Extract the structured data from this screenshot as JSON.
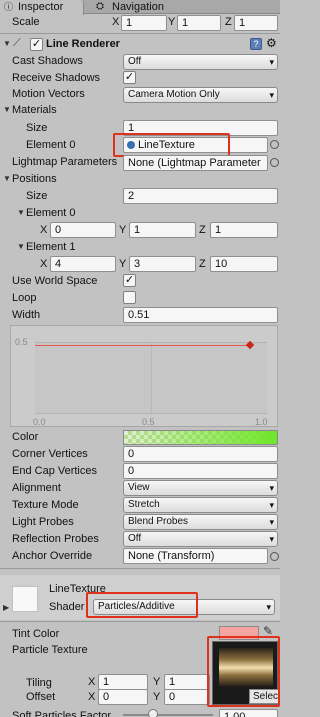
{
  "tabs": {
    "inspector": "Inspector",
    "navigation": "Navigation"
  },
  "scale": {
    "label": "Scale",
    "x": "1",
    "y": "1",
    "z": "1"
  },
  "line_renderer": {
    "title": "Line Renderer",
    "cast_shadows": {
      "label": "Cast Shadows",
      "value": "Off"
    },
    "receive_shadows": {
      "label": "Receive Shadows",
      "checked": true
    },
    "motion_vectors": {
      "label": "Motion Vectors",
      "value": "Camera Motion Only"
    },
    "materials": {
      "label": "Materials",
      "size_label": "Size",
      "size": "1",
      "element0_label": "Element 0",
      "element0": "LineTexture"
    },
    "lightmap": {
      "label": "Lightmap Parameters",
      "value": "None (Lightmap Parameter"
    },
    "positions": {
      "label": "Positions",
      "size_label": "Size",
      "size": "2",
      "e0": {
        "label": "Element 0",
        "x": "0",
        "y": "1",
        "z": "1"
      },
      "e1": {
        "label": "Element 1",
        "x": "4",
        "y": "3",
        "z": "10"
      }
    },
    "use_world_space": {
      "label": "Use World Space",
      "checked": true
    },
    "loop": {
      "label": "Loop",
      "checked": false
    },
    "width": {
      "label": "Width",
      "value": "0.51"
    },
    "curve": {
      "y_tick": "0.5",
      "x_ticks": [
        "0.0",
        "0.5",
        "1.0"
      ]
    },
    "color": {
      "label": "Color"
    },
    "corner_vertices": {
      "label": "Corner Vertices",
      "value": "0"
    },
    "end_cap_vertices": {
      "label": "End Cap Vertices",
      "value": "0"
    },
    "alignment": {
      "label": "Alignment",
      "value": "View"
    },
    "texture_mode": {
      "label": "Texture Mode",
      "value": "Stretch"
    },
    "light_probes": {
      "label": "Light Probes",
      "value": "Blend Probes"
    },
    "reflection_probes": {
      "label": "Reflection Probes",
      "value": "Off"
    },
    "anchor_override": {
      "label": "Anchor Override",
      "value": "None (Transform)"
    }
  },
  "material": {
    "name": "LineTexture",
    "shader_label": "Shader",
    "shader": "Particles/Additive",
    "tint_color": {
      "label": "Tint Color"
    },
    "particle_texture": {
      "label": "Particle Texture",
      "select": "Select"
    },
    "tiling": {
      "label": "Tiling",
      "x": "1",
      "y": "1"
    },
    "offset": {
      "label": "Offset",
      "x": "0",
      "y": "0"
    },
    "soft": {
      "label": "Soft Particles Factor",
      "value": "1.00"
    }
  },
  "axis": {
    "x": "X",
    "y": "Y",
    "z": "Z"
  }
}
